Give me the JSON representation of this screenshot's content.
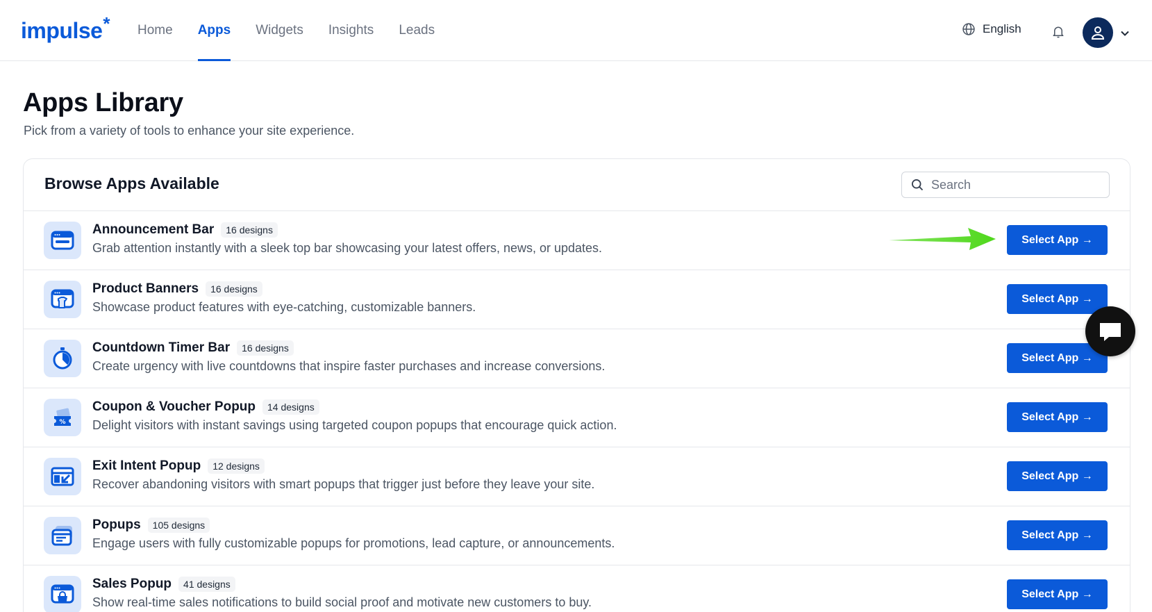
{
  "brand": {
    "logo_text": "impulse",
    "logo_mark": "*"
  },
  "nav": {
    "items": [
      {
        "label": "Home",
        "active": false
      },
      {
        "label": "Apps",
        "active": true
      },
      {
        "label": "Widgets",
        "active": false
      },
      {
        "label": "Insights",
        "active": false
      },
      {
        "label": "Leads",
        "active": false
      }
    ]
  },
  "header": {
    "language": "English",
    "icons": [
      "globe-icon",
      "bell-icon",
      "user-icon",
      "chevron-down-icon"
    ]
  },
  "page": {
    "title": "Apps Library",
    "subtitle": "Pick from a variety of tools to enhance your site experience."
  },
  "card": {
    "title": "Browse Apps Available",
    "search_placeholder": "Search",
    "apps": [
      {
        "name": "Announcement Bar",
        "designs": "16 designs",
        "description": "Grab attention instantly with a sleek top bar showcasing your latest offers, news, or updates.",
        "button": "Select App →",
        "icon": "browser-window-icon"
      },
      {
        "name": "Product Banners",
        "designs": "16 designs",
        "description": "Showcase product features with eye-catching, customizable banners.",
        "button": "Select App →",
        "icon": "shirt-window-icon"
      },
      {
        "name": "Countdown Timer Bar",
        "designs": "16 designs",
        "description": "Create urgency with live countdowns that inspire faster purchases and increase conversions.",
        "button": "Select App →",
        "icon": "stopwatch-icon"
      },
      {
        "name": "Coupon & Voucher Popup",
        "designs": "14 designs",
        "description": "Delight visitors with instant savings using targeted coupon popups that encourage quick action.",
        "button": "Select App →",
        "icon": "coupon-icon"
      },
      {
        "name": "Exit Intent Popup",
        "designs": "12 designs",
        "description": "Recover abandoning visitors with smart popups that trigger just before they leave your site.",
        "button": "Select App →",
        "icon": "exit-window-icon"
      },
      {
        "name": "Popups",
        "designs": "105 designs",
        "description": "Engage users with fully customizable popups for promotions, lead capture, or announcements.",
        "button": "Select App →",
        "icon": "stacked-windows-icon"
      },
      {
        "name": "Sales Popup",
        "designs": "41 designs",
        "description": "Show real-time sales notifications to build social proof and motivate new customers to buy.",
        "button": "Select App →",
        "icon": "shopping-bag-window-icon"
      }
    ]
  },
  "colors": {
    "primary": "#0b5ad9",
    "icon_bg": "#dbe7fb",
    "annotation_arrow": "#4fd81b",
    "chat_fab": "#111111"
  }
}
